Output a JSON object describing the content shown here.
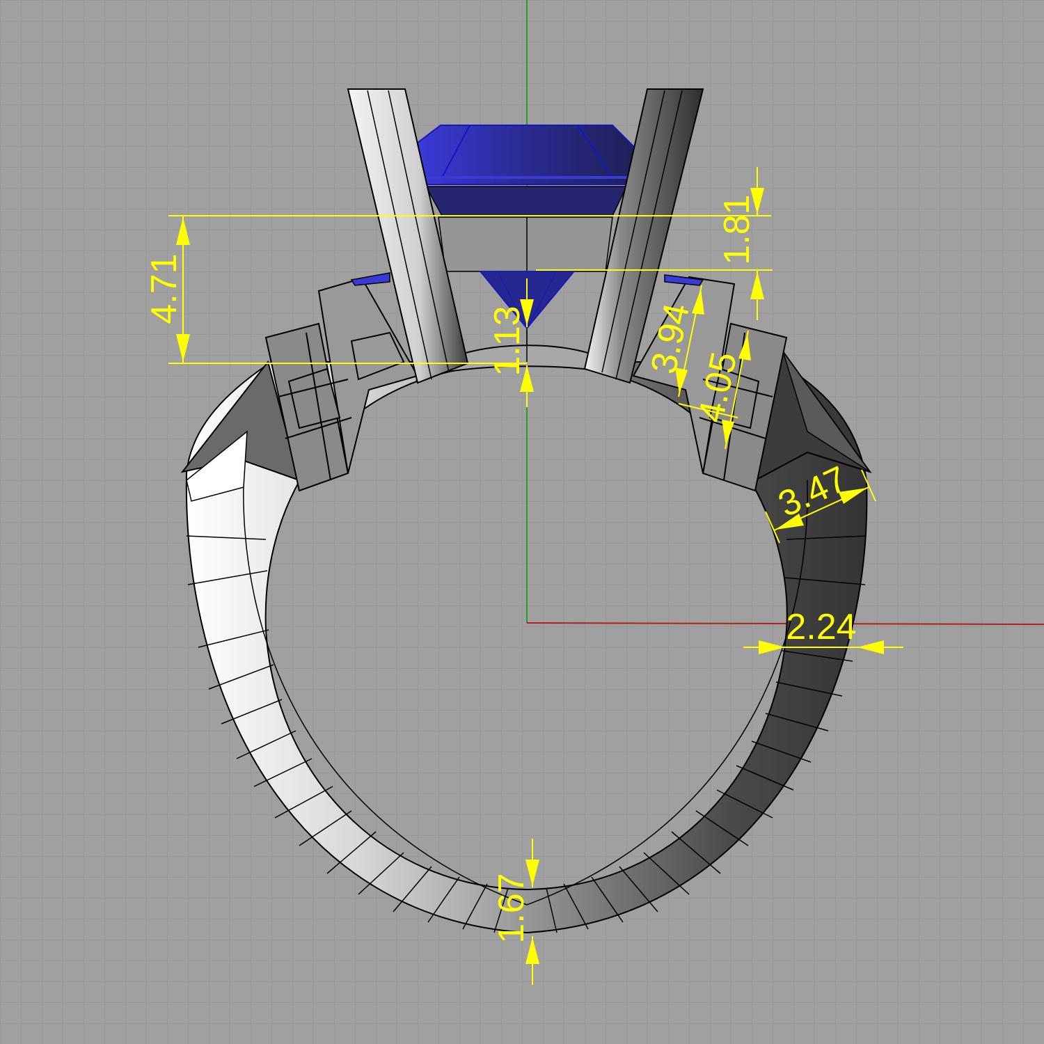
{
  "viewport": {
    "background_color": "#a0a0a0",
    "grid_color": "#8f8f8f",
    "x_axis_color": "#b02020",
    "y_axis_color": "#2a9a2a"
  },
  "model": {
    "gem_color": "#2a2a90",
    "gem_light_color": "#3a3ad8",
    "metal_light_color": "#e8e8e8",
    "metal_dark_color": "#3a3a3a",
    "edge_color": "#000000"
  },
  "dimension_style": {
    "color": "#ffff00",
    "icon": "arrow-head-icon"
  },
  "dimensions": {
    "center_height": "4.71",
    "table_to_girdle": "1.81",
    "culet_clearance": "1.13",
    "side_stone_inner": "3.94",
    "side_stone_outer": "4.05",
    "shoulder_width": "3.47",
    "shank_width": "2.24",
    "bottom_thickness": "1.67"
  }
}
